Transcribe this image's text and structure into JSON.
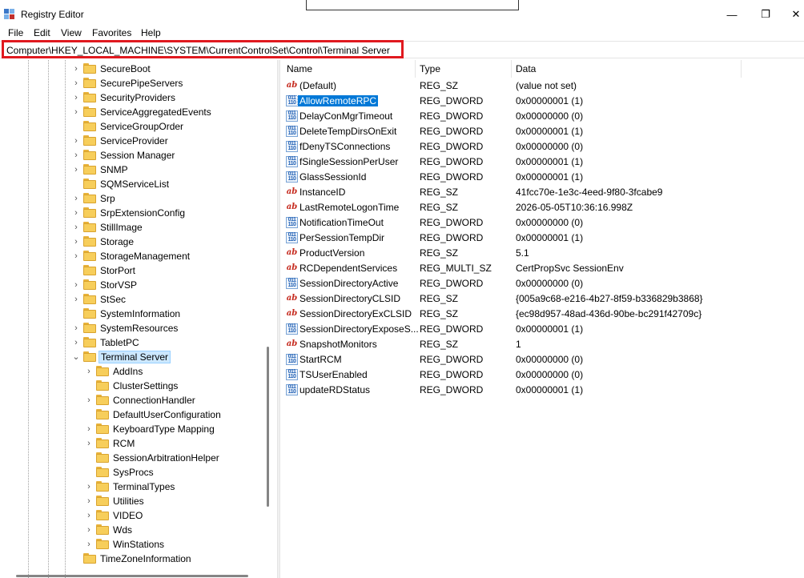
{
  "window": {
    "title": "Registry Editor",
    "minimize": "—",
    "maximize": "❐",
    "close": "✕"
  },
  "menu": [
    "File",
    "Edit",
    "View",
    "Favorites",
    "Help"
  ],
  "address": "Computer\\HKEY_LOCAL_MACHINE\\SYSTEM\\CurrentControlSet\\Control\\Terminal Server",
  "tree": [
    {
      "label": "SecureBoot",
      "expander": "›",
      "level": 1
    },
    {
      "label": "SecurePipeServers",
      "expander": "›",
      "level": 1
    },
    {
      "label": "SecurityProviders",
      "expander": "›",
      "level": 1
    },
    {
      "label": "ServiceAggregatedEvents",
      "expander": "›",
      "level": 1
    },
    {
      "label": "ServiceGroupOrder",
      "expander": "",
      "level": 1
    },
    {
      "label": "ServiceProvider",
      "expander": "›",
      "level": 1
    },
    {
      "label": "Session Manager",
      "expander": "›",
      "level": 1
    },
    {
      "label": "SNMP",
      "expander": "›",
      "level": 1
    },
    {
      "label": "SQMServiceList",
      "expander": "",
      "level": 1
    },
    {
      "label": "Srp",
      "expander": "›",
      "level": 1
    },
    {
      "label": "SrpExtensionConfig",
      "expander": "›",
      "level": 1
    },
    {
      "label": "StillImage",
      "expander": "›",
      "level": 1
    },
    {
      "label": "Storage",
      "expander": "›",
      "level": 1
    },
    {
      "label": "StorageManagement",
      "expander": "›",
      "level": 1
    },
    {
      "label": "StorPort",
      "expander": "",
      "level": 1
    },
    {
      "label": "StorVSP",
      "expander": "›",
      "level": 1
    },
    {
      "label": "StSec",
      "expander": "›",
      "level": 1
    },
    {
      "label": "SystemInformation",
      "expander": "",
      "level": 1
    },
    {
      "label": "SystemResources",
      "expander": "›",
      "level": 1
    },
    {
      "label": "TabletPC",
      "expander": "›",
      "level": 1
    },
    {
      "label": "Terminal Server",
      "expander": "⌄",
      "level": 1,
      "selected": true
    },
    {
      "label": "AddIns",
      "expander": "›",
      "level": 2
    },
    {
      "label": "ClusterSettings",
      "expander": "",
      "level": 2
    },
    {
      "label": "ConnectionHandler",
      "expander": "›",
      "level": 2
    },
    {
      "label": "DefaultUserConfiguration",
      "expander": "",
      "level": 2
    },
    {
      "label": "KeyboardType Mapping",
      "expander": "›",
      "level": 2
    },
    {
      "label": "RCM",
      "expander": "›",
      "level": 2
    },
    {
      "label": "SessionArbitrationHelper",
      "expander": "",
      "level": 2
    },
    {
      "label": "SysProcs",
      "expander": "",
      "level": 2
    },
    {
      "label": "TerminalTypes",
      "expander": "›",
      "level": 2
    },
    {
      "label": "Utilities",
      "expander": "›",
      "level": 2
    },
    {
      "label": "VIDEO",
      "expander": "›",
      "level": 2
    },
    {
      "label": "Wds",
      "expander": "›",
      "level": 2
    },
    {
      "label": "WinStations",
      "expander": "›",
      "level": 2
    },
    {
      "label": "TimeZoneInformation",
      "expander": "",
      "level": 1
    }
  ],
  "columns": {
    "name": "Name",
    "type": "Type",
    "data": "Data"
  },
  "values": [
    {
      "icon": "ab",
      "kind": "sz",
      "name": "(Default)",
      "type": "REG_SZ",
      "data": "(value not set)"
    },
    {
      "icon": "011 110",
      "kind": "bin",
      "name": "AllowRemoteRPC",
      "type": "REG_DWORD",
      "data": "0x00000001 (1)",
      "selected": true
    },
    {
      "icon": "011 110",
      "kind": "bin",
      "name": "DelayConMgrTimeout",
      "type": "REG_DWORD",
      "data": "0x00000000 (0)"
    },
    {
      "icon": "011 110",
      "kind": "bin",
      "name": "DeleteTempDirsOnExit",
      "type": "REG_DWORD",
      "data": "0x00000001 (1)"
    },
    {
      "icon": "011 110",
      "kind": "bin",
      "name": "fDenyTSConnections",
      "type": "REG_DWORD",
      "data": "0x00000000 (0)"
    },
    {
      "icon": "011 110",
      "kind": "bin",
      "name": "fSingleSessionPerUser",
      "type": "REG_DWORD",
      "data": "0x00000001 (1)"
    },
    {
      "icon": "011 110",
      "kind": "bin",
      "name": "GlassSessionId",
      "type": "REG_DWORD",
      "data": "0x00000001 (1)"
    },
    {
      "icon": "ab",
      "kind": "sz",
      "name": "InstanceID",
      "type": "REG_SZ",
      "data": "41fcc70e-1e3c-4eed-9f80-3fcabe9"
    },
    {
      "icon": "ab",
      "kind": "sz",
      "name": "LastRemoteLogonTime",
      "type": "REG_SZ",
      "data": "2026-05-05T10:36:16.998Z"
    },
    {
      "icon": "011 110",
      "kind": "bin",
      "name": "NotificationTimeOut",
      "type": "REG_DWORD",
      "data": "0x00000000 (0)"
    },
    {
      "icon": "011 110",
      "kind": "bin",
      "name": "PerSessionTempDir",
      "type": "REG_DWORD",
      "data": "0x00000001 (1)"
    },
    {
      "icon": "ab",
      "kind": "sz",
      "name": "ProductVersion",
      "type": "REG_SZ",
      "data": "5.1"
    },
    {
      "icon": "ab",
      "kind": "sz",
      "name": "RCDependentServices",
      "type": "REG_MULTI_SZ",
      "data": "CertPropSvc SessionEnv"
    },
    {
      "icon": "011 110",
      "kind": "bin",
      "name": "SessionDirectoryActive",
      "type": "REG_DWORD",
      "data": "0x00000000 (0)"
    },
    {
      "icon": "ab",
      "kind": "sz",
      "name": "SessionDirectoryCLSID",
      "type": "REG_SZ",
      "data": "{005a9c68-e216-4b27-8f59-b336829b3868}"
    },
    {
      "icon": "ab",
      "kind": "sz",
      "name": "SessionDirectoryExCLSID",
      "type": "REG_SZ",
      "data": "{ec98d957-48ad-436d-90be-bc291f42709c}"
    },
    {
      "icon": "011 110",
      "kind": "bin",
      "name": "SessionDirectoryExposeS...",
      "type": "REG_DWORD",
      "data": "0x00000001 (1)"
    },
    {
      "icon": "ab",
      "kind": "sz",
      "name": "SnapshotMonitors",
      "type": "REG_SZ",
      "data": "1"
    },
    {
      "icon": "011 110",
      "kind": "bin",
      "name": "StartRCM",
      "type": "REG_DWORD",
      "data": "0x00000000 (0)"
    },
    {
      "icon": "011 110",
      "kind": "bin",
      "name": "TSUserEnabled",
      "type": "REG_DWORD",
      "data": "0x00000000 (0)"
    },
    {
      "icon": "011 110",
      "kind": "bin",
      "name": "updateRDStatus",
      "type": "REG_DWORD",
      "data": "0x00000001 (1)"
    }
  ]
}
